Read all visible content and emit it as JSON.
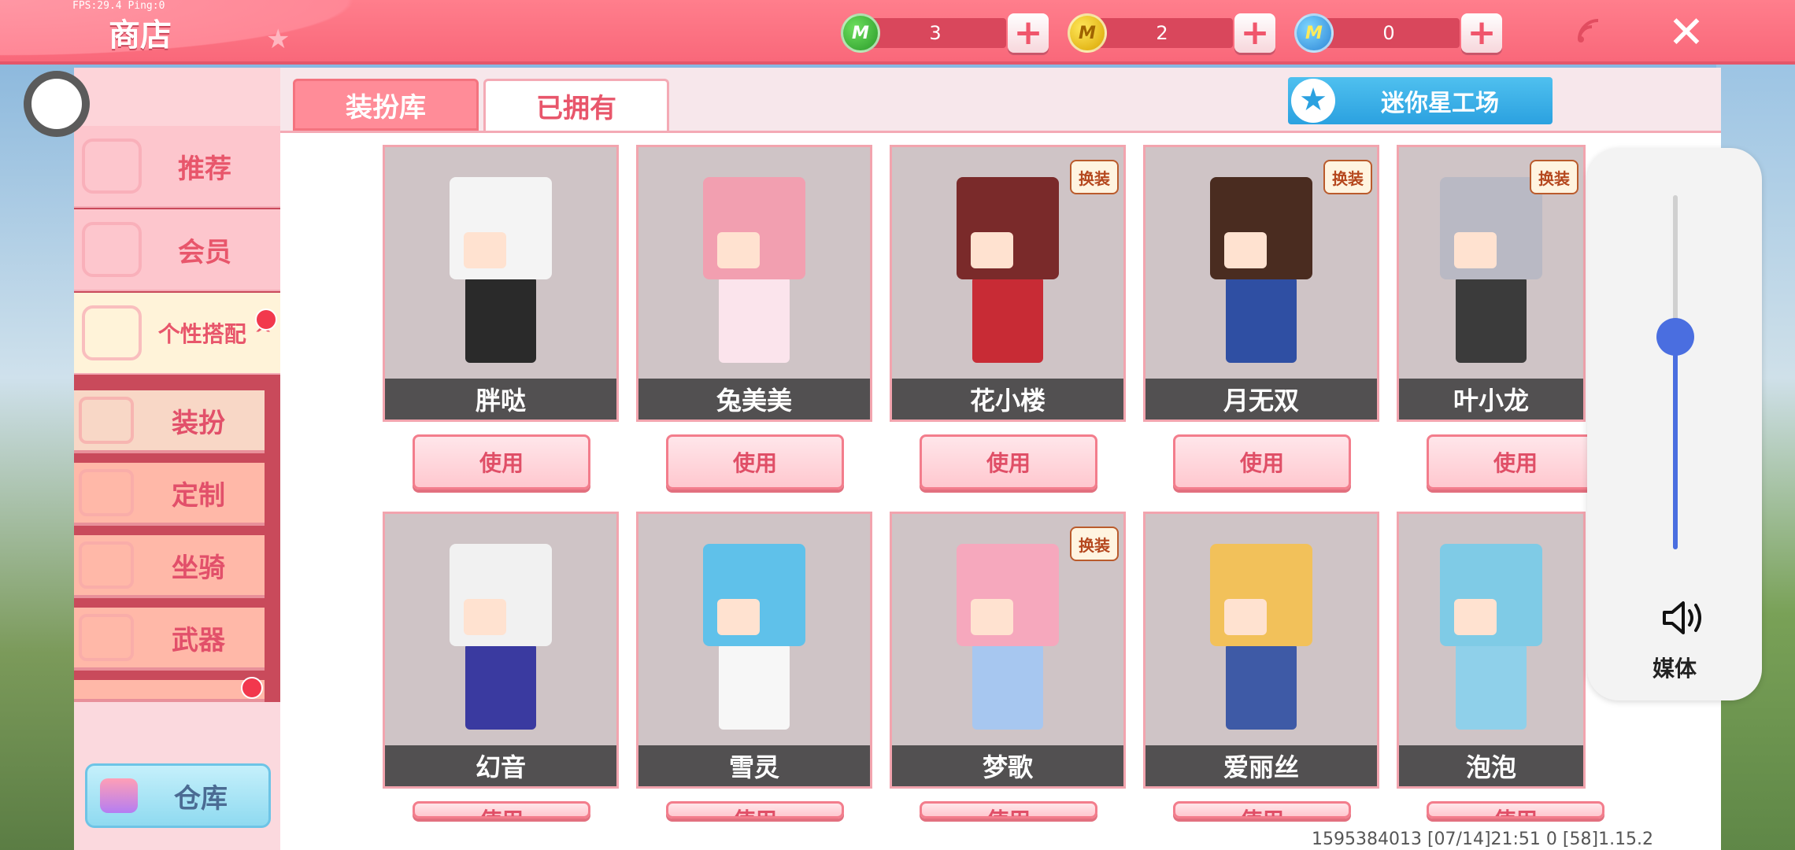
{
  "debug": {
    "fps_text": "FPS:29.4  Ping:0"
  },
  "header": {
    "title": "商店"
  },
  "currencies": [
    {
      "icon": "green-mini-coin-icon",
      "letter": "M",
      "value": "3",
      "color": "#2a9a2a"
    },
    {
      "icon": "gold-mini-coin-icon",
      "letter": "M",
      "value": "2",
      "color": "#d9a400"
    },
    {
      "icon": "blue-mini-coin-icon",
      "letter": "M",
      "value": "0",
      "color": "#2d86d6"
    }
  ],
  "plus_symbol": "+",
  "close_symbol": "✕",
  "sidebar": {
    "items": [
      {
        "label": "推荐"
      },
      {
        "label": "会员"
      },
      {
        "label": "个性搭配 ^"
      }
    ],
    "sub_items": [
      {
        "label": "装扮"
      },
      {
        "label": "定制"
      },
      {
        "label": "坐骑"
      },
      {
        "label": "武器"
      }
    ],
    "warehouse_label": "仓库"
  },
  "tabs": [
    {
      "label": "装扮库",
      "active": false
    },
    {
      "label": "已拥有",
      "active": true
    }
  ],
  "workshop": {
    "label": "迷你星工场",
    "icon_symbol": "★"
  },
  "badge_text": "换装",
  "use_label": "使用",
  "cards": [
    {
      "name": "胖哒",
      "badge": false,
      "head_color": "#f4f4f4",
      "body_color": "#2a2a2a"
    },
    {
      "name": "兔美美",
      "badge": false,
      "head_color": "#f29fb0",
      "body_color": "#fbe4ec"
    },
    {
      "name": "花小楼",
      "badge": true,
      "head_color": "#7a2a2a",
      "body_color": "#c82b35"
    },
    {
      "name": "月无双",
      "badge": true,
      "head_color": "#4a2c20",
      "body_color": "#2f4fa3"
    },
    {
      "name": "叶小龙",
      "badge": true,
      "head_color": "#b9b9c4",
      "body_color": "#3b3b3b"
    },
    {
      "name": "幻音",
      "badge": false,
      "head_color": "#f1f1f1",
      "body_color": "#3a3aa0"
    },
    {
      "name": "雪灵",
      "badge": false,
      "head_color": "#5fc1ea",
      "body_color": "#f7f7f7"
    },
    {
      "name": "梦歌",
      "badge": true,
      "head_color": "#f6a8bd",
      "body_color": "#a7c7f0"
    },
    {
      "name": "爱丽丝",
      "badge": false,
      "head_color": "#f2c15a",
      "body_color": "#3e5aa6"
    },
    {
      "name": "泡泡",
      "badge": false,
      "head_color": "#7fcbe6",
      "body_color": "#8fd0ea"
    }
  ],
  "volume": {
    "label": "媒体",
    "level": 0.6
  },
  "footer": {
    "info": "1595384013  [07/14]21:51 0  [58]1.15.2"
  }
}
